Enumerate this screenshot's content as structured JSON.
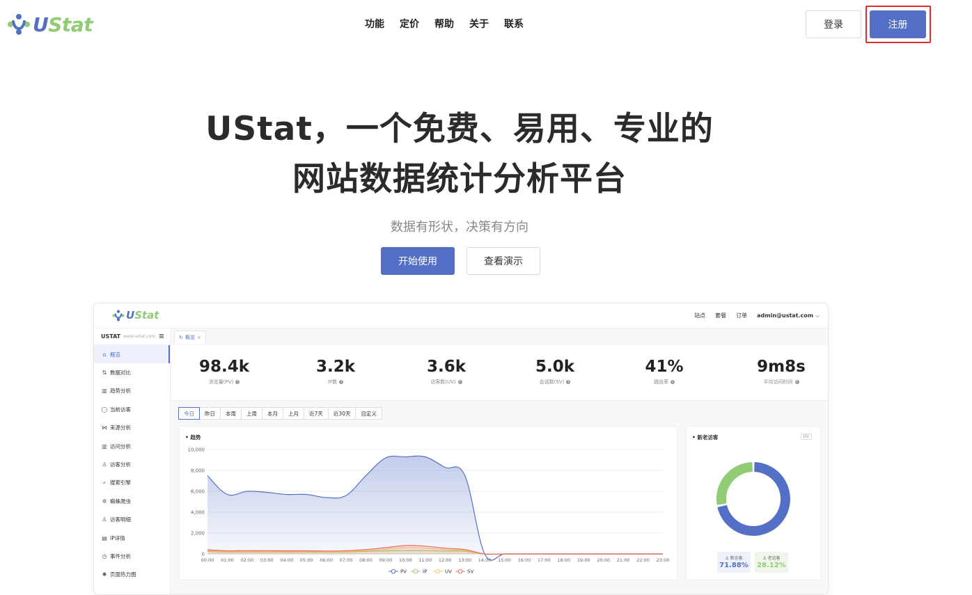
{
  "logo": {
    "part1": "U",
    "part2": "Stat"
  },
  "nav": {
    "items": [
      "功能",
      "定价",
      "帮助",
      "关于",
      "联系"
    ]
  },
  "auth": {
    "login": "登录",
    "register": "注册"
  },
  "hero": {
    "title_line1": "UStat，一个免费、易用、专业的",
    "title_line2": "网站数据统计分析平台",
    "subtitle": "数据有形状，决策有方向",
    "start": "开始使用",
    "demo": "查看演示"
  },
  "dashboard": {
    "logo": {
      "part1": "U",
      "part2": "Stat"
    },
    "topright": {
      "sites": "站点",
      "plan": "套餐",
      "orders": "订单",
      "user": "admin@ustat.com"
    },
    "sidebar": {
      "title": "USTAT",
      "site": "www.ustat.com",
      "items": [
        {
          "icon": "⌂",
          "label": "概览",
          "active": true
        },
        {
          "icon": "⇅",
          "label": "数据对比"
        },
        {
          "icon": "▥",
          "label": "趋势分析"
        },
        {
          "icon": "◯",
          "label": "当前访客"
        },
        {
          "icon": "⋈",
          "label": "来源分析"
        },
        {
          "icon": "▥",
          "label": "访问分析"
        },
        {
          "icon": "♙",
          "label": "访客分析"
        },
        {
          "icon": "⌕",
          "label": "搜索引擎"
        },
        {
          "icon": "✲",
          "label": "蜘蛛爬虫"
        },
        {
          "icon": "♙",
          "label": "访客明细"
        },
        {
          "icon": "▤",
          "label": "IP详情"
        },
        {
          "icon": "◷",
          "label": "事件分析"
        },
        {
          "icon": "✺",
          "label": "页面热力图"
        }
      ]
    },
    "tab": {
      "label": "概览",
      "close": "×"
    },
    "stats": [
      {
        "value": "98.4k",
        "label": "浏览量(PV)"
      },
      {
        "value": "3.2k",
        "label": "IP数"
      },
      {
        "value": "3.6k",
        "label": "访客数(UV)"
      },
      {
        "value": "5.0k",
        "label": "会话数(SV)"
      },
      {
        "value": "41%",
        "label": "跳出率"
      },
      {
        "value": "9m8s",
        "label": "平均访问时间"
      }
    ],
    "ranges": [
      "今日",
      "昨日",
      "本周",
      "上周",
      "本月",
      "上月",
      "近7天",
      "近30天",
      "自定义"
    ],
    "trend_title": "趋势",
    "donut_title": "新老访客",
    "uv_tag": "UV",
    "ratio": {
      "new_label": "新访客",
      "new_value": "71.88%",
      "old_label": "老访客",
      "old_value": "28.12%"
    }
  },
  "chart_data": [
    {
      "type": "area",
      "title": "趋势",
      "categories": [
        "00:00",
        "01:00",
        "02:00",
        "03:00",
        "04:00",
        "05:00",
        "06:00",
        "07:00",
        "08:00",
        "09:00",
        "10:00",
        "11:00",
        "12:00",
        "13:00",
        "14:00",
        "15:00",
        "16:00",
        "17:00",
        "18:00",
        "19:00",
        "20:00",
        "21:00",
        "22:00",
        "23:00"
      ],
      "ylim": [
        0,
        10000
      ],
      "yticks": [
        "10,000",
        "8,000",
        "6,000",
        "4,000",
        "2,000",
        "0"
      ],
      "series": [
        {
          "name": "PV",
          "color": "#5470c6",
          "values": [
            7500,
            5700,
            6000,
            5900,
            5700,
            5700,
            5400,
            5600,
            7500,
            9200,
            9300,
            9300,
            8300,
            7500,
            0,
            0,
            0,
            0,
            0,
            0,
            0,
            0,
            0,
            0
          ]
        },
        {
          "name": "IP",
          "color": "#91cc75",
          "values": [
            250,
            180,
            200,
            190,
            180,
            180,
            170,
            190,
            250,
            300,
            320,
            320,
            280,
            260,
            0,
            0,
            0,
            0,
            0,
            0,
            0,
            0,
            0,
            0
          ]
        },
        {
          "name": "UV",
          "color": "#fac858",
          "values": [
            300,
            220,
            240,
            230,
            220,
            220,
            200,
            230,
            320,
            450,
            600,
            560,
            420,
            320,
            0,
            0,
            0,
            0,
            0,
            0,
            0,
            0,
            0,
            0
          ]
        },
        {
          "name": "SV",
          "color": "#ee6666",
          "values": [
            400,
            300,
            320,
            310,
            300,
            300,
            280,
            310,
            420,
            600,
            800,
            750,
            550,
            420,
            0,
            0,
            0,
            0,
            0,
            0,
            0,
            0,
            0,
            0
          ]
        }
      ],
      "legend": "bottom"
    },
    {
      "type": "pie",
      "title": "新老访客",
      "categories": [
        "新访客",
        "老访客"
      ],
      "values": [
        71.88,
        28.12
      ],
      "colors": [
        "#5470c6",
        "#91cc75"
      ]
    }
  ]
}
